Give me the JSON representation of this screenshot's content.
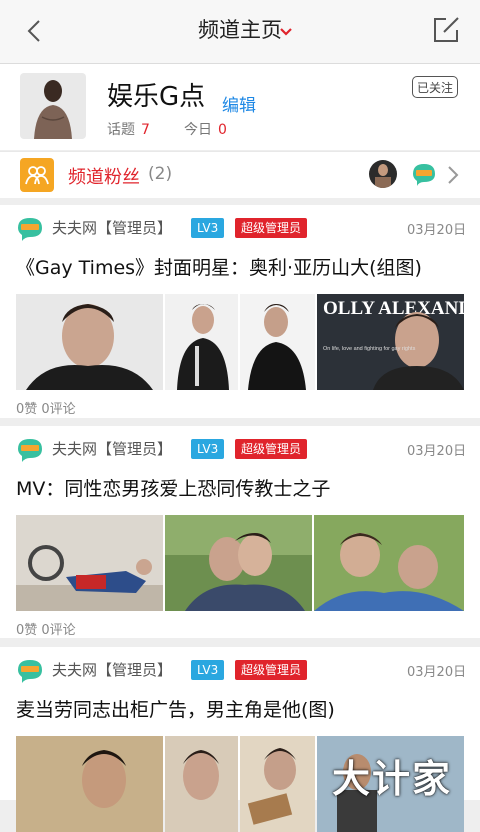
{
  "topbar": {
    "title": "频道主页",
    "back_icon": "back-chevron-icon",
    "dropdown_icon": "chevron-down-icon",
    "edit_icon": "edit-square-icon",
    "accent": "#e0242c"
  },
  "channel": {
    "name": "娱乐G点",
    "edit_label": "编辑",
    "follow_label": "已关注",
    "topics_label": "话题",
    "topics_count": "7",
    "today_label": "今日",
    "today_count": "0"
  },
  "fans": {
    "label": "频道粉丝",
    "count": "(2)",
    "icon": "users-icon",
    "icon_color": "#f5a623"
  },
  "posts": [
    {
      "author": "夫夫网【管理员】",
      "level": "LV3",
      "role": "超级管理员",
      "date": "03月20日",
      "title": "《Gay Times》封面明星：奥利·亚历山大(组图)",
      "stats": "0赞  0评论",
      "magazine_text": "OLLY ALEXANDER",
      "magazine_caption": "On life, love and fighting for gay rights"
    },
    {
      "author": "夫夫网【管理员】",
      "level": "LV3",
      "role": "超级管理员",
      "date": "03月20日",
      "title": "MV：同性恋男孩爱上恐同传教士之子",
      "stats": "0赞  0评论"
    },
    {
      "author": "夫夫网【管理员】",
      "level": "LV3",
      "role": "超级管理员",
      "date": "03月20日",
      "title": "麦当劳同志出柜广告，男主角是他(图)"
    }
  ],
  "watermark": "大计家"
}
